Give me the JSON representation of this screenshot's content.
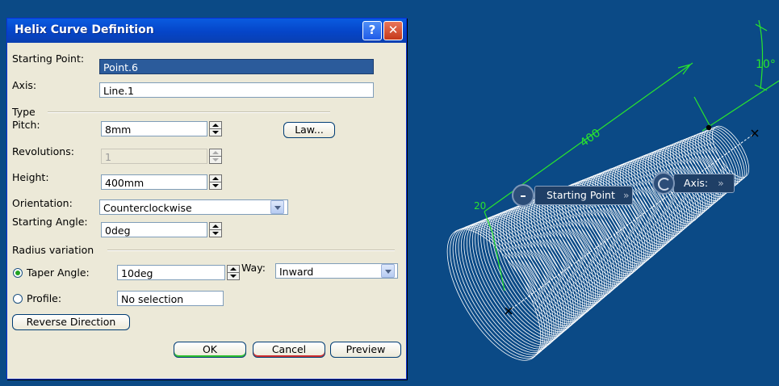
{
  "dialog": {
    "title": "Helix Curve Definition",
    "help_icon": "?",
    "close_icon": "✕",
    "starting_point": {
      "label": "Starting Point:",
      "value": "Point.6"
    },
    "axis": {
      "label": "Axis:",
      "value": "Line.1"
    },
    "type": {
      "heading": "Type",
      "pitch": {
        "label": "Pitch:",
        "value": "8mm"
      },
      "law_button": "Law...",
      "revolutions": {
        "label": "Revolutions:",
        "value": "1"
      },
      "height": {
        "label": "Height:",
        "value": "400mm"
      },
      "orientation": {
        "label": "Orientation:",
        "value": "Counterclockwise"
      },
      "starting_angle": {
        "label": "Starting Angle:",
        "value": "0deg"
      }
    },
    "radius_variation": {
      "heading": "Radius variation",
      "taper_angle": {
        "label": "Taper Angle:",
        "value": "10deg",
        "checked": true
      },
      "way": {
        "label": "Way:",
        "value": "Inward"
      },
      "profile": {
        "label": "Profile:",
        "value": "No selection",
        "checked": false
      }
    },
    "reverse_direction_button": "Reverse Direction",
    "ok_button": "OK",
    "cancel_button": "Cancel",
    "preview_button": "Preview"
  },
  "viewport": {
    "starting_point_tag": "Starting Point",
    "axis_tag": "Axis:",
    "tag_chevron": "»",
    "dim_length": "400",
    "dim_angle": "10°",
    "dim_small": "20",
    "colors": {
      "background": "#0b4a86",
      "helix": "#ffffff",
      "dimension": "#29e52d"
    }
  }
}
